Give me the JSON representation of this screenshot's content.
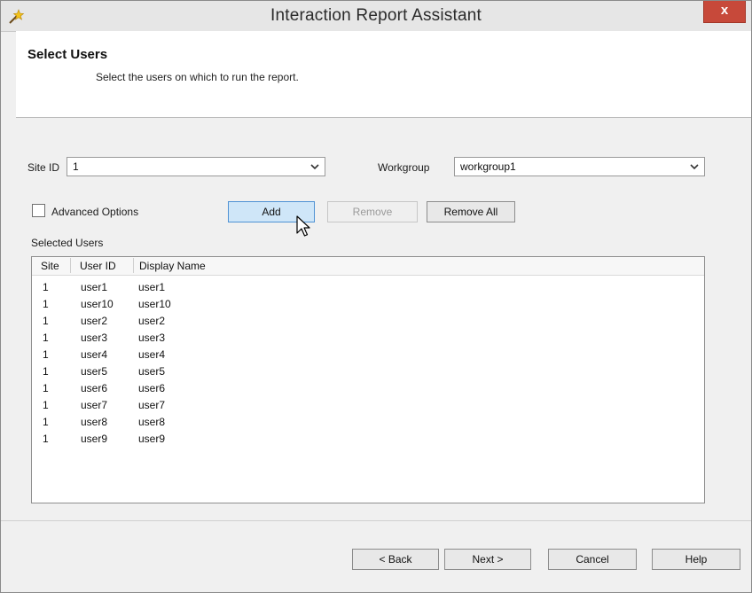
{
  "window": {
    "title": "Interaction Report Assistant",
    "close_label": "x"
  },
  "header": {
    "title": "Select Users",
    "subtitle": "Select the users on which to run the report."
  },
  "filters": {
    "site_id_label": "Site ID",
    "site_id_value": "1",
    "workgroup_label": "Workgroup",
    "workgroup_value": "workgroup1"
  },
  "options": {
    "advanced_label": "Advanced Options",
    "advanced_checked": false
  },
  "actions": {
    "add": "Add",
    "remove": "Remove",
    "remove_all": "Remove All"
  },
  "selected_users": {
    "label": "Selected Users",
    "columns": [
      "Site",
      "User ID",
      "Display Name"
    ],
    "rows": [
      [
        "1",
        "user1",
        "user1"
      ],
      [
        "1",
        "user10",
        "user10"
      ],
      [
        "1",
        "user2",
        "user2"
      ],
      [
        "1",
        "user3",
        "user3"
      ],
      [
        "1",
        "user4",
        "user4"
      ],
      [
        "1",
        "user5",
        "user5"
      ],
      [
        "1",
        "user6",
        "user6"
      ],
      [
        "1",
        "user7",
        "user7"
      ],
      [
        "1",
        "user8",
        "user8"
      ],
      [
        "1",
        "user9",
        "user9"
      ]
    ]
  },
  "footer": {
    "back": "< Back",
    "next": "Next >",
    "cancel": "Cancel",
    "help": "Help"
  },
  "icons": {
    "app": "wizard-wand-icon",
    "close": "close-icon",
    "dropdown": "chevron-down-icon",
    "cursor": "mouse-pointer-icon"
  },
  "colors": {
    "close_button": "#c7493a",
    "primary_button": "#cfe6f8",
    "primary_border": "#4f92d4"
  }
}
